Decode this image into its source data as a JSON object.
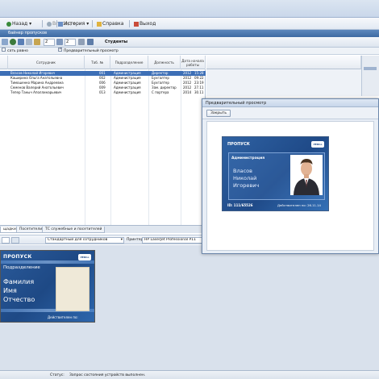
{
  "menubar": {
    "items": [
      {
        "label": "Назад",
        "icon": "back-arrow-icon"
      },
      {
        "label": "Вперед",
        "icon": "forward-arrow-icon"
      },
      {
        "label": "История",
        "icon": "history-icon"
      },
      {
        "label": "Справка",
        "icon": "help-icon"
      },
      {
        "label": "Выход",
        "icon": "exit-icon"
      }
    ]
  },
  "appbar": {
    "title": "байнер пропусков"
  },
  "toolbar": {
    "field1": "2",
    "field2": "2",
    "mode_label": "Студенты"
  },
  "filterbar": {
    "left_label": "сать равно",
    "preview_checkbox": {
      "label": "Предварительный просмотр",
      "checked": true
    }
  },
  "grid": {
    "columns": [
      "Сотрудник",
      "Таб. №",
      "Подразделение",
      "Должность",
      "Дата начала работы"
    ],
    "rows": [
      {
        "name": "Власов Николай Игоревич",
        "tab": "001",
        "dept": "Администрация",
        "position": "Директор",
        "date": "2012",
        "time": "15:28",
        "selected": true
      },
      {
        "name": "Каширина Ольга Анатольевна",
        "tab": "002",
        "dept": "Администрация",
        "position": "Бухгалтер",
        "date": "2012",
        "time": "09:22"
      },
      {
        "name": "Тимошенко Марина Андреевна",
        "tab": "006",
        "dept": "Администрация",
        "position": "Бухгалтер",
        "date": "2012",
        "time": "23:19"
      },
      {
        "name": "Семенов Валерий Анатольевич",
        "tab": "009",
        "dept": "Администрация",
        "position": "Зам. директор",
        "date": "2012",
        "time": "27.11"
      },
      {
        "name": "Тепер Таныч Аполлинарьевич",
        "tab": "013",
        "dept": "Администрация",
        "position": "С портера",
        "date": "2014",
        "time": "30.11"
      }
    ]
  },
  "tabs": [
    {
      "label": "щадки",
      "active": true
    },
    {
      "label": "Посетители",
      "active": false
    },
    {
      "label": "ТС служебные и посетителей",
      "active": false
    }
  ],
  "printbar": {
    "template": "Стандартный для сотрудников",
    "printer_label": "Принтер:",
    "printer": "HP LaserJet Professional P11"
  },
  "bigcard": {
    "title": "ПРОПУСК",
    "dept": "Подразделение",
    "lines": [
      "Фамилия",
      "Имя",
      "Отчество"
    ],
    "valid_label": "Действителен по:"
  },
  "preview": {
    "title": "Предварительный просмотр",
    "close_label": "Закрыть"
  },
  "smallcard": {
    "title": "ПРОПУСК",
    "dept": "Администрация",
    "lines": [
      "Власов",
      "Николай",
      "Игоревич"
    ],
    "id": "ID: 111/65526",
    "valid": "Действителен по: 26.11.14"
  },
  "statusbar": {
    "label": "Статус:",
    "text": "Запрос состояния устройств выполнен."
  },
  "colors": {
    "accent": "#3d6fb6",
    "card_blue": "#1f4a88"
  }
}
